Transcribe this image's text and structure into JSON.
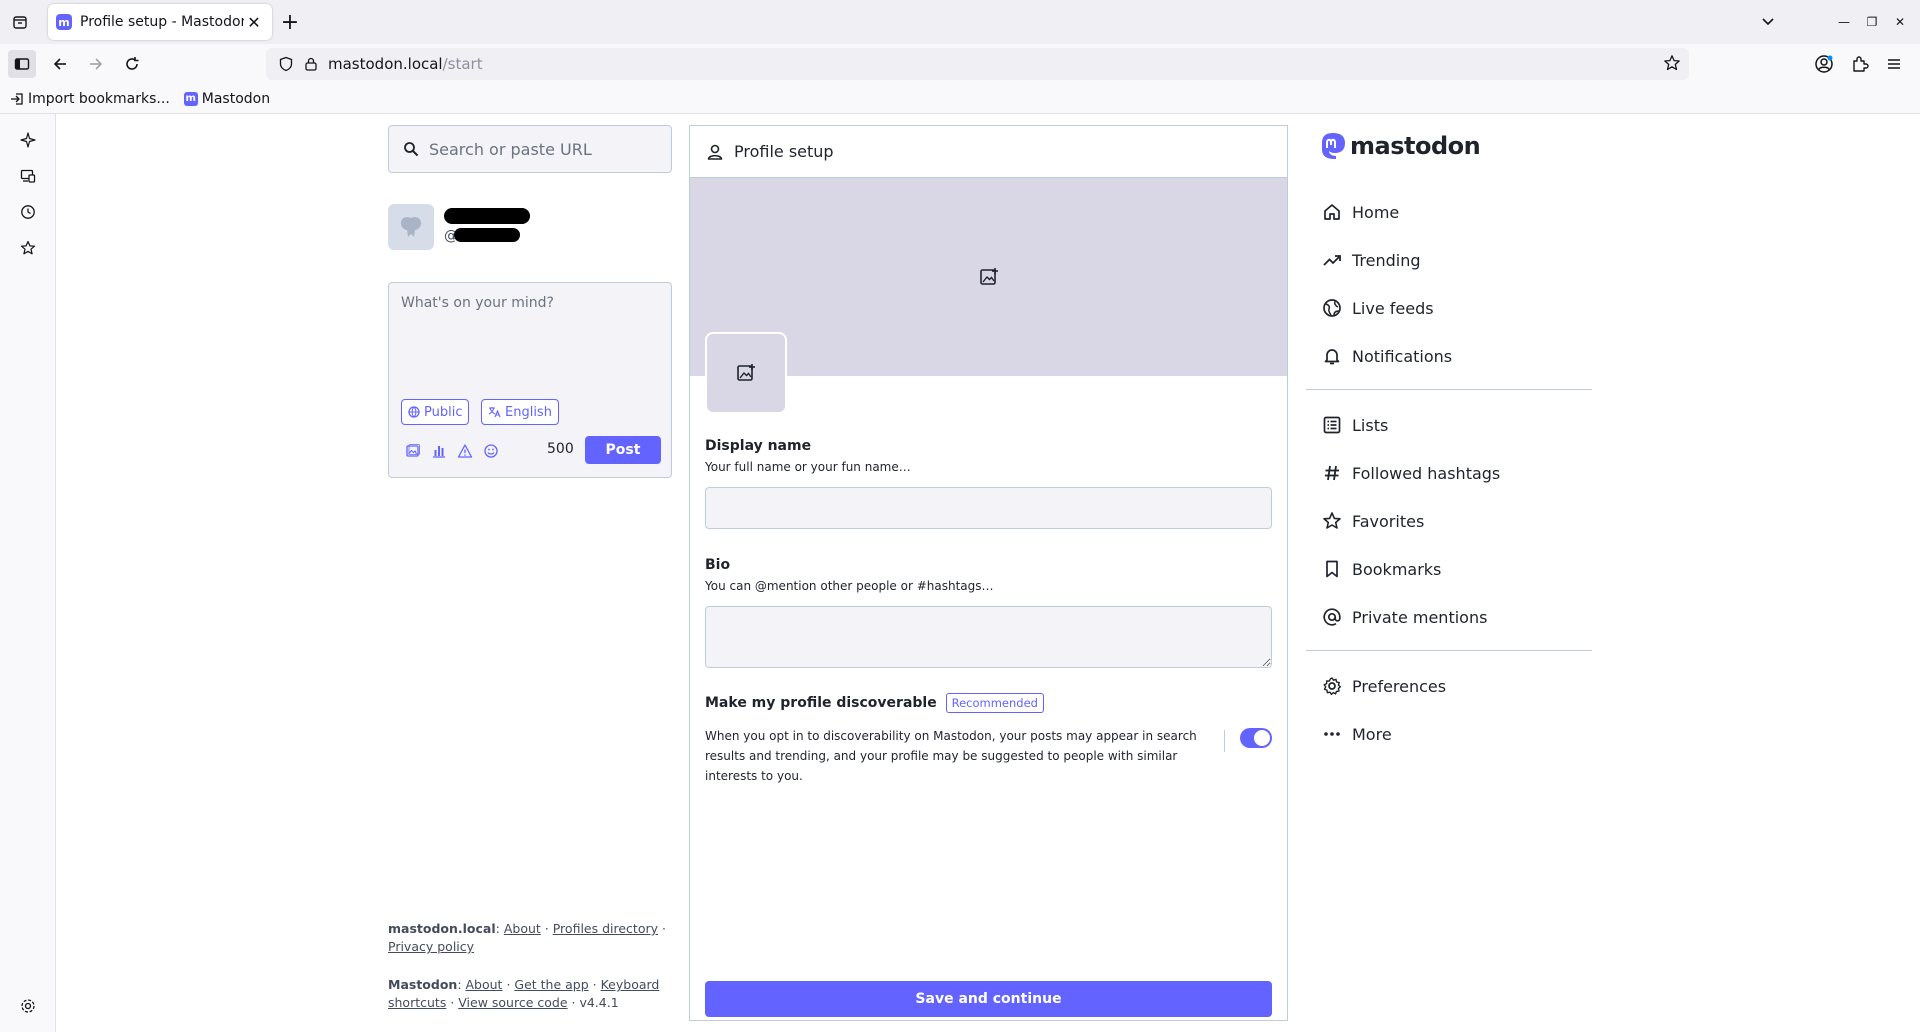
{
  "browser": {
    "tab_title": "Profile setup - Mastodon",
    "url_host": "mastodon.local",
    "url_path": "/start",
    "bookmarks": [
      "Import bookmarks...",
      "Mastodon"
    ]
  },
  "compose": {
    "search_placeholder": "Search or paste URL",
    "account_at": "@",
    "textarea_placeholder": "What's on your mind?",
    "visibility_label": "Public",
    "language_label": "English",
    "char_count": "500",
    "post_label": "Post"
  },
  "footer": {
    "server": "mastodon.local",
    "server_links": [
      "About",
      "Profiles directory",
      "Privacy policy"
    ],
    "app": "Mastodon",
    "app_links": [
      "About",
      "Get the app",
      "Keyboard shortcuts",
      "View source code"
    ],
    "version": "v4.4.1"
  },
  "profile_setup": {
    "title": "Profile setup",
    "display_name_label": "Display name",
    "display_name_hint": "Your full name or your fun name…",
    "display_name_value": "",
    "bio_label": "Bio",
    "bio_hint": "You can @mention other people or #hashtags…",
    "bio_value": "",
    "discoverable_label": "Make my profile discoverable",
    "discoverable_badge": "Recommended",
    "discoverable_desc": "When you opt in to discoverability on Mastodon, your posts may appear in search results and trending, and your profile may be suggested to people with similar interests to you.",
    "discoverable_on": true,
    "save_label": "Save and continue"
  },
  "nav": {
    "logo_text": "mastodon",
    "items_top": [
      {
        "label": "Home",
        "icon": "home-icon"
      },
      {
        "label": "Trending",
        "icon": "trending-icon"
      },
      {
        "label": "Live feeds",
        "icon": "globe-icon"
      },
      {
        "label": "Notifications",
        "icon": "bell-icon"
      }
    ],
    "items_mid": [
      {
        "label": "Lists",
        "icon": "list-icon"
      },
      {
        "label": "Followed hashtags",
        "icon": "hashtag-icon"
      },
      {
        "label": "Favorites",
        "icon": "star-icon"
      },
      {
        "label": "Bookmarks",
        "icon": "bookmark-icon"
      },
      {
        "label": "Private mentions",
        "icon": "at-icon"
      }
    ],
    "items_bottom": [
      {
        "label": "Preferences",
        "icon": "gear-icon"
      },
      {
        "label": "More",
        "icon": "more-icon"
      }
    ]
  },
  "colors": {
    "accent": "#6364ff",
    "header_placeholder": "#d9d6e6",
    "border": "#c0cdd9"
  }
}
